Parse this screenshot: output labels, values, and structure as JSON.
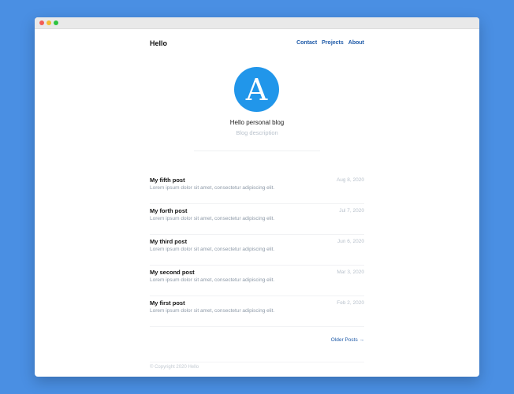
{
  "site": {
    "title": "Hello",
    "nav": [
      "Contact",
      "Projects",
      "About"
    ],
    "avatar_letter": "A",
    "avatar_color": "#2196ea",
    "blog_name": "Hello personal blog",
    "blog_description": "Blog description"
  },
  "posts": [
    {
      "title": "My fifth post",
      "excerpt": "Lorem ipsum dolor sit amet, consectetur adipiscing elit.",
      "date": "Aug 8, 2020"
    },
    {
      "title": "My forth post",
      "excerpt": "Lorem ipsum dolor sit amet, consectetur adipiscing elit.",
      "date": "Jul 7, 2020"
    },
    {
      "title": "My third post",
      "excerpt": "Lorem ipsum dolor sit amet, consectetur adipiscing elit.",
      "date": "Jun 6, 2020"
    },
    {
      "title": "My second post",
      "excerpt": "Lorem ipsum dolor sit amet, consectetur adipiscing elit.",
      "date": "Mar 3, 2020"
    },
    {
      "title": "My first post",
      "excerpt": "Lorem ipsum dolor sit amet, consectetur adipiscing elit.",
      "date": "Feb 2, 2020"
    }
  ],
  "pagination": {
    "older_label": "Older Posts →"
  },
  "footer": {
    "copyright": "© Copyright 2020 Hello"
  },
  "window": {
    "controls": [
      "close-dot",
      "minimize-dot",
      "maximize-dot"
    ]
  }
}
